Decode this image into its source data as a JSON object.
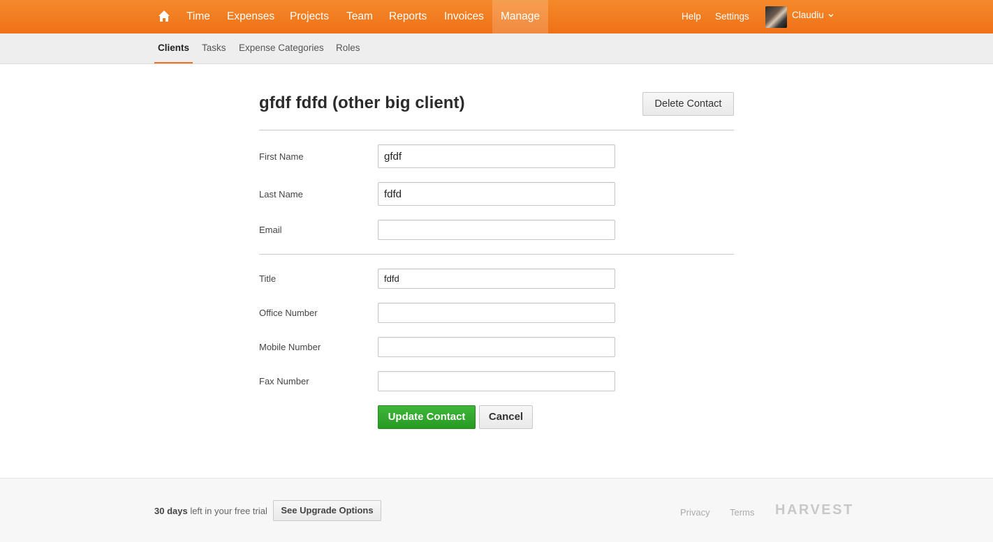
{
  "topnav": {
    "home_icon": "home-icon",
    "items": [
      "Time",
      "Expenses",
      "Projects",
      "Team",
      "Reports",
      "Invoices",
      "Manage"
    ],
    "active": "Manage",
    "help": "Help",
    "settings": "Settings",
    "user_name": "Claudiu",
    "accent_color": "#f58a2b"
  },
  "subnav": {
    "items": [
      "Clients",
      "Tasks",
      "Expense Categories",
      "Roles"
    ],
    "active": "Clients"
  },
  "contact": {
    "title": "gfdf fdfd (other big client)",
    "delete_label": "Delete Contact"
  },
  "form": {
    "first_name": {
      "label": "First Name",
      "value": "gfdf"
    },
    "last_name": {
      "label": "Last Name",
      "value": "fdfd"
    },
    "email": {
      "label": "Email",
      "value": ""
    },
    "title": {
      "label": "Title",
      "value": "fdfd"
    },
    "office_number": {
      "label": "Office Number",
      "value": ""
    },
    "mobile_number": {
      "label": "Mobile Number",
      "value": ""
    },
    "fax_number": {
      "label": "Fax Number",
      "value": ""
    },
    "update_label": "Update Contact",
    "cancel_label": "Cancel",
    "update_color": "#3fb53a"
  },
  "footer": {
    "trial_days": "30 days",
    "trial_text": " left in your free trial",
    "upgrade_label": "See Upgrade Options",
    "privacy": "Privacy",
    "terms": "Terms",
    "logo": "HARVEST"
  }
}
